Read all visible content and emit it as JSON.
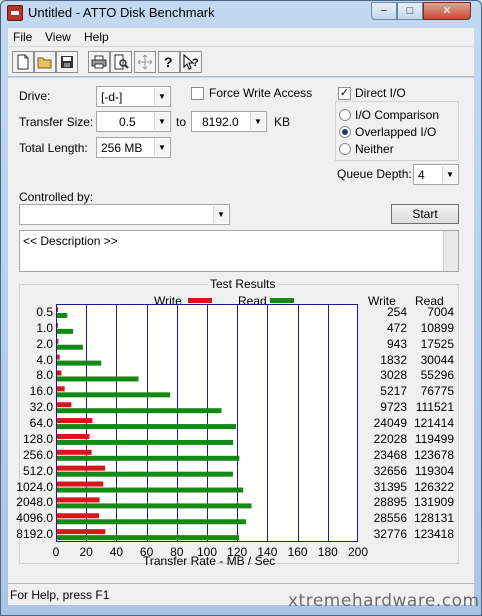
{
  "window": {
    "title": "Untitled - ATTO Disk Benchmark",
    "minimize": "−",
    "maximize": "□",
    "close": "✕"
  },
  "menu": {
    "items": [
      "File",
      "View",
      "Help"
    ]
  },
  "toolbar": {
    "icons": [
      "new-file-icon",
      "open-folder-icon",
      "save-icon",
      "print-icon",
      "print-preview-icon",
      "move-icon",
      "help-icon",
      "context-help-icon"
    ]
  },
  "form": {
    "drive_label": "Drive:",
    "drive_value": "[-d-]",
    "force_write_label": "Force Write Access",
    "force_write_checked": false,
    "direct_io_label": "Direct I/O",
    "direct_io_checked": true,
    "transfer_size_label": "Transfer Size:",
    "transfer_from": "0.5",
    "to_label": "to",
    "transfer_to": "8192.0",
    "kb_label": "KB",
    "total_length_label": "Total Length:",
    "total_length_value": "256 MB",
    "io_comparison_label": "I/O Comparison",
    "overlapped_io_label": "Overlapped I/O",
    "neither_label": "Neither",
    "selected_io_mode": "Overlapped I/O",
    "queue_depth_label": "Queue Depth:",
    "queue_depth_value": "4",
    "controlled_by_label": "Controlled by:",
    "controlled_by_value": "",
    "start_label": "Start",
    "description_text": "<< Description >>"
  },
  "results": {
    "title": "Test Results",
    "legend_write": "Write",
    "legend_read": "Read",
    "col_write": "Write",
    "col_read": "Read",
    "write_color": "#d9151b",
    "read_color": "#148a14",
    "grid_color": "#1f1a8c",
    "axis_label": "Transfer Rate - MB / Sec"
  },
  "chart_data": {
    "type": "bar",
    "orientation": "horizontal",
    "categories": [
      "0.5",
      "1.0",
      "2.0",
      "4.0",
      "8.0",
      "16.0",
      "32.0",
      "64.0",
      "128.0",
      "256.0",
      "512.0",
      "1024.0",
      "2048.0",
      "4096.0",
      "8192.0"
    ],
    "series": [
      {
        "name": "Write",
        "values": [
          254,
          472,
          943,
          1832,
          3028,
          5217,
          9723,
          24049,
          22028,
          23468,
          32656,
          31395,
          28895,
          28556,
          32776
        ]
      },
      {
        "name": "Read",
        "values": [
          7004,
          10899,
          17525,
          30044,
          55296,
          76775,
          111521,
          121414,
          119499,
          123678,
          119304,
          126322,
          131909,
          128131,
          123418
        ]
      }
    ],
    "value_units": "KB/s",
    "xlabel": "Transfer Rate - MB / Sec",
    "xticks": [
      "0",
      "20",
      "40",
      "60",
      "80",
      "100",
      "120",
      "140",
      "160",
      "180",
      "200"
    ],
    "xlim": [
      0,
      200
    ],
    "grid": true,
    "legend_position": "top"
  },
  "status": {
    "text": "For Help, press F1"
  },
  "watermark": {
    "text": "xtremehardware.com"
  }
}
